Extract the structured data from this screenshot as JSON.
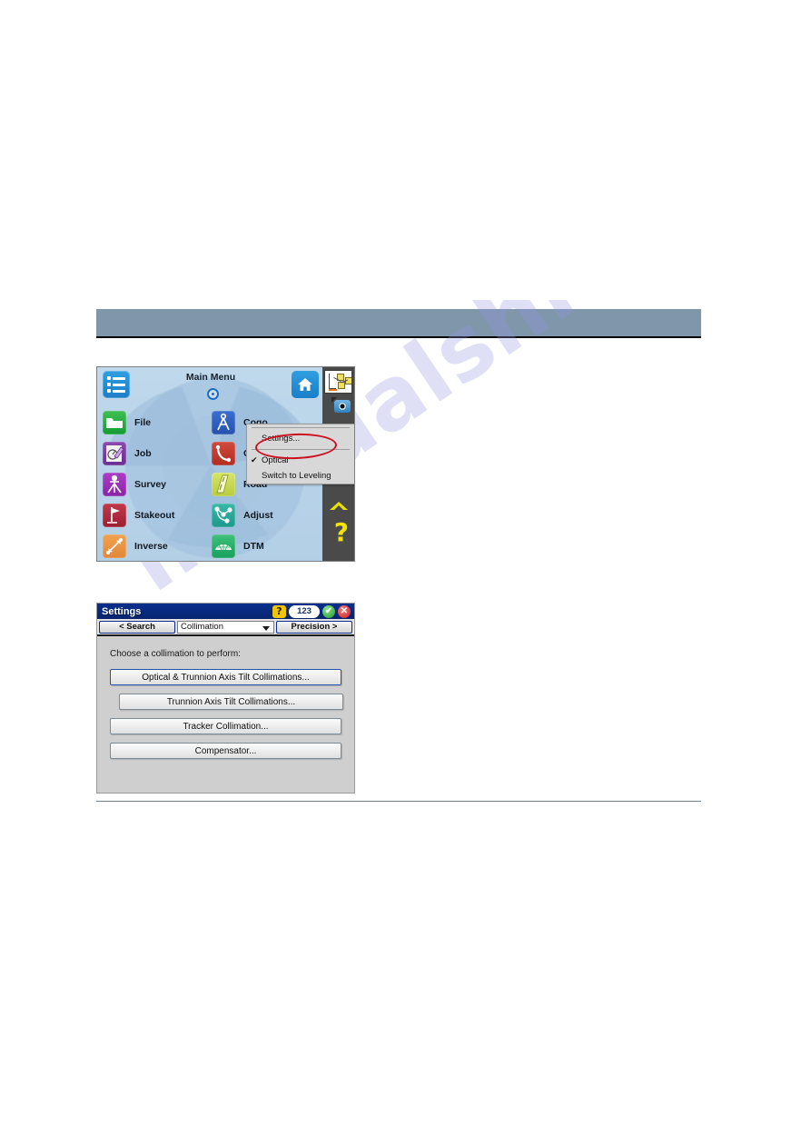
{
  "page": {
    "header_band_color": "#8096ab",
    "watermark_text": "manualshive.com"
  },
  "main_menu": {
    "title": "Main Menu",
    "hamburger_icon": "list-menu-icon",
    "home_icon": "home-icon",
    "thumbnail_icon": "map-thumbnail-icon",
    "camera_icon": "camera-icon",
    "chevron_icon": "chevron-up-icon",
    "help_icon": "?",
    "left_column": [
      {
        "label": "File",
        "icon": "folder-icon"
      },
      {
        "label": "Job",
        "icon": "job-pencil-icon"
      },
      {
        "label": "Survey",
        "icon": "tripod-icon"
      },
      {
        "label": "Stakeout",
        "icon": "flag-icon"
      },
      {
        "label": "Inverse",
        "icon": "inverse-arrow-icon"
      }
    ],
    "right_column": [
      {
        "label": "Cogo",
        "icon": "compass-divider-icon"
      },
      {
        "label": "Curve",
        "icon": "curve-icon"
      },
      {
        "label": "Road",
        "icon": "road-icon"
      },
      {
        "label": "Adjust",
        "icon": "adjust-network-icon"
      },
      {
        "label": "DTM",
        "icon": "dtm-mesh-icon"
      }
    ],
    "popup_menu": {
      "items": [
        {
          "label": "Settings...",
          "checked": false,
          "highlighted": true
        },
        {
          "label": "Optical",
          "checked": true,
          "highlighted": false
        },
        {
          "label": "Switch to Leveling",
          "checked": false,
          "highlighted": false
        }
      ],
      "checkmark": "✔",
      "annotation_color": "#cc1020"
    }
  },
  "settings_dialog": {
    "title": "Settings",
    "titlebar_buttons": {
      "help": "?",
      "numeric": "123",
      "accept": "✔",
      "close": "✕"
    },
    "toolbar": {
      "back_label": "< Search",
      "combo_value": "Collimation",
      "next_label": "Precision >"
    },
    "prompt": "Choose a collimation to perform:",
    "actions": [
      {
        "label": "Optical & Trunnion Axis Tilt Collimations...",
        "focused": true,
        "inset": false
      },
      {
        "label": "Trunnion Axis Tilt Collimations...",
        "focused": false,
        "inset": true
      },
      {
        "label": "Tracker Collimation...",
        "focused": false,
        "inset": false
      },
      {
        "label": "Compensator...",
        "focused": false,
        "inset": false
      }
    ]
  }
}
